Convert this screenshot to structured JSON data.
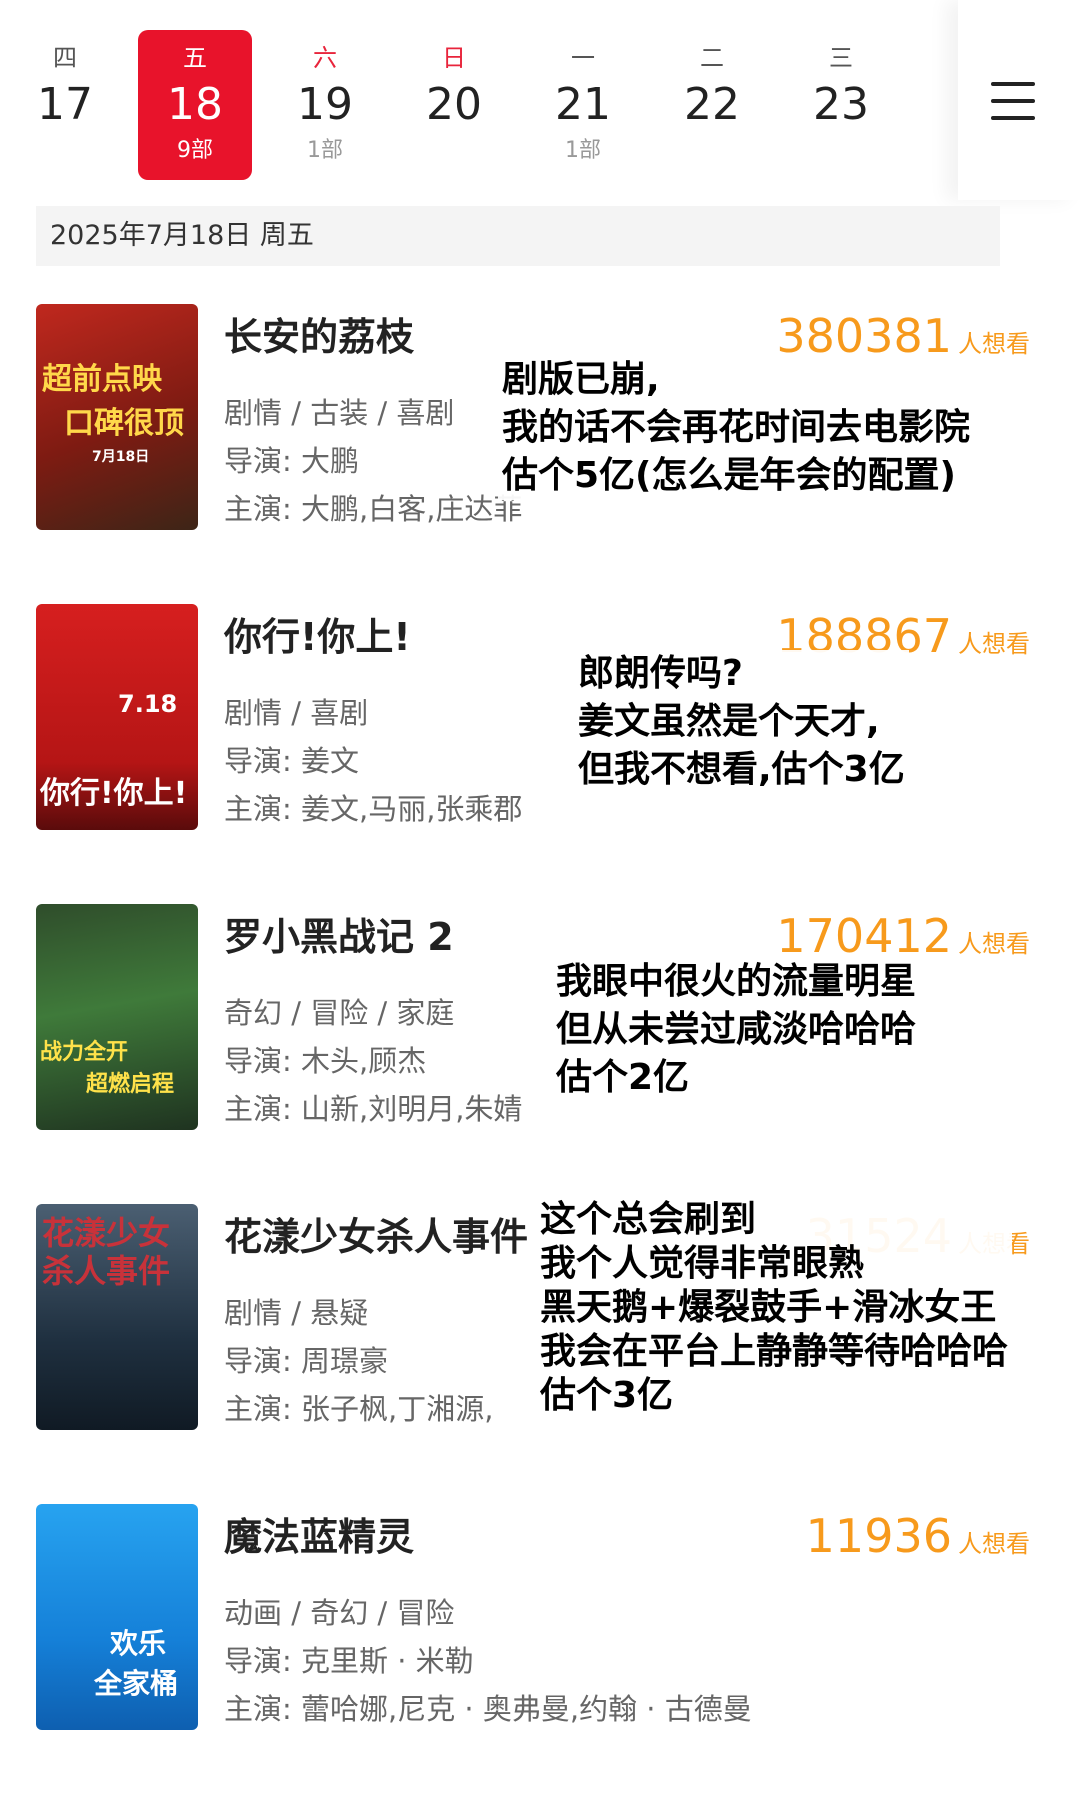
{
  "date_strip": {
    "days": [
      {
        "weekday": "四",
        "date": "17",
        "count": ""
      },
      {
        "weekday": "五",
        "date": "18",
        "count": "9部"
      },
      {
        "weekday": "六",
        "date": "19",
        "count": "1部"
      },
      {
        "weekday": "日",
        "date": "20",
        "count": ""
      },
      {
        "weekday": "一",
        "date": "21",
        "count": "1部"
      },
      {
        "weekday": "二",
        "date": "22",
        "count": ""
      },
      {
        "weekday": "三",
        "date": "23",
        "count": ""
      }
    ],
    "selected_index": 1
  },
  "date_header": "2025年7月18日  周五",
  "want_suffix": "人想看",
  "movies": [
    {
      "title": "长安的荔枝",
      "want": "380381",
      "genre": "剧情 / 古装 / 喜剧",
      "director": "导演:  大鹏",
      "cast": "主演:  大鹏,白客,庄达菲",
      "poster_text": [
        "超前点映",
        "口碑很顶",
        "7月18日"
      ],
      "note": [
        "剧版已崩,",
        "我的话不会再花时间去电影院",
        "估个5亿(怎么是年会的配置)"
      ]
    },
    {
      "title": "你行!你上!",
      "want": "188867",
      "genre": "剧情 / 喜剧",
      "director": "导演:  姜文",
      "cast": "主演:  姜文,马丽,张乘郡",
      "poster_text": [
        "7.18",
        "你行!你上!"
      ],
      "note": [
        "郎朗传吗?",
        "姜文虽然是个天才,",
        "但我不想看,估个3亿"
      ]
    },
    {
      "title": "罗小黑战记 2",
      "want": "170412",
      "genre": "奇幻 / 冒险 / 家庭",
      "director": "导演:  木头,顾杰",
      "cast": "主演:  山新,刘明月,朱婧",
      "poster_text": [
        "战力全开",
        "超燃启程"
      ],
      "note": [
        "我眼中很火的流量明星",
        "但从未尝过咸淡哈哈哈",
        "估个2亿"
      ]
    },
    {
      "title": "花漾少女杀人事件",
      "want": "31524",
      "genre": "剧情 / 悬疑",
      "director": "导演:  周璟豪",
      "cast": "主演:  张子枫,丁湘源,",
      "poster_text": [
        "花漾少女",
        "杀人事件"
      ],
      "note": [
        "这个总会刷到",
        "我个人觉得非常眼熟",
        "黑天鹅+爆裂鼓手+滑冰女王",
        "我会在平台上静静等待哈哈哈",
        "估个3亿"
      ]
    },
    {
      "title": "魔法蓝精灵",
      "want": "11936",
      "genre": "动画 / 奇幻 / 冒险",
      "director": "导演:  克里斯 · 米勒",
      "cast": "主演:  蕾哈娜,尼克 · 奥弗曼,约翰 · 古德曼",
      "poster_text": [
        "欢乐",
        "全家桶"
      ],
      "note": []
    }
  ],
  "colors": {
    "accent_red": "#e8132b",
    "want_orange": "#f79a1c",
    "weekend_red": "#e8243b"
  }
}
